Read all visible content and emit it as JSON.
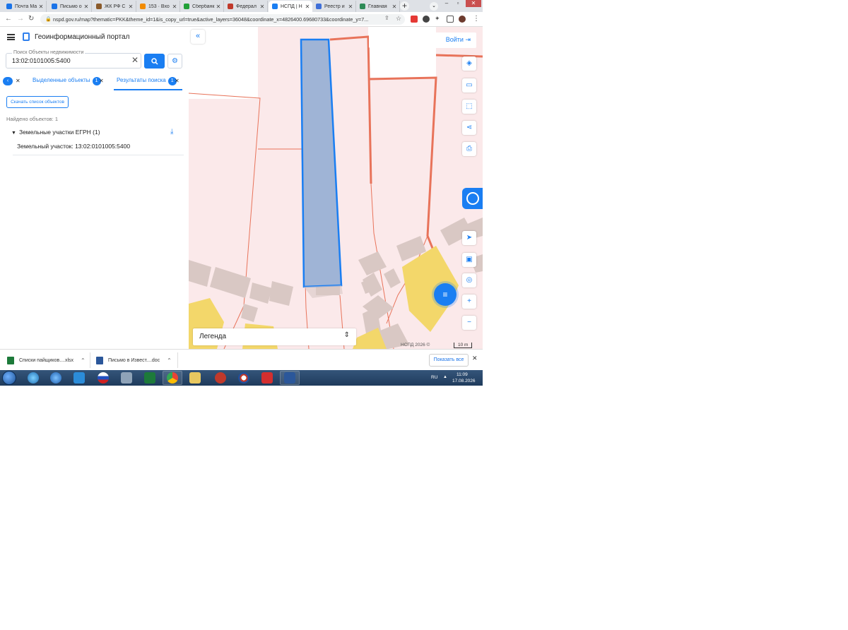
{
  "browser": {
    "tabs": [
      {
        "title": "Почта Ма",
        "favicon_color": "#1a73e8"
      },
      {
        "title": "Письмо о",
        "favicon_color": "#1a73e8"
      },
      {
        "title": "ЖК РФ С",
        "favicon_color": "#8a5a2b"
      },
      {
        "title": "153 · Вхо",
        "favicon_color": "#f28b00"
      },
      {
        "title": "Сбербанк",
        "favicon_color": "#21a038"
      },
      {
        "title": "Федерал",
        "favicon_color": "#c0392b"
      },
      {
        "title": "НСПД | Н",
        "favicon_color": "#1a7ef2",
        "active": true
      },
      {
        "title": "Реестр и",
        "favicon_color": "#3f6fd8"
      },
      {
        "title": "Главная",
        "favicon_color": "#2e8b57"
      }
    ],
    "new_tab_symbol": "+",
    "tab_close_symbol": "✕",
    "url": "nspd.gov.ru/map?thematic=PKK&theme_id=1&is_copy_url=true&active_layers=36048&coordinate_x=4826400.69680733&coordinate_y=7..."
  },
  "panel": {
    "portal_title": "Геоинформационный портал",
    "search_label": "Поиск Объекты недвижимости",
    "search_value": "13:02:0101005:5400",
    "tabs": [
      {
        "label": "Выделенные объекты",
        "count": "1"
      },
      {
        "label": "Результаты поиска",
        "count": "1"
      }
    ],
    "download_list_label": "Скачать список объектов",
    "found_count": "Найдено объектов: 1",
    "group_label": "Земельные участки ЕГРН (1)",
    "result_item": "Земельный участок: 13:02:0101005:5400"
  },
  "map": {
    "login_label": "Войти",
    "legend_label": "Легенда",
    "attribution": "НСПД 2026 ©",
    "scale_label": "10 m",
    "colors": {
      "parcel_fill": "#fbe9ea",
      "parcel_border": "#e8735a",
      "selected_fill": "#9fb4d6",
      "selected_border": "#1a7ef2",
      "building": "#d9c8c4",
      "building_yellow": "#f3d76a"
    }
  },
  "downloads": {
    "items": [
      {
        "name": "Списки пайщиков....xlsx",
        "icon_color": "#1d7a3a"
      },
      {
        "name": "Письмо в Извест....doc",
        "icon_color": "#2b579a"
      }
    ],
    "show_all_label": "Показать все"
  },
  "taskbar": {
    "lang": "RU",
    "time": "11:09",
    "date": "17.08.2026"
  }
}
